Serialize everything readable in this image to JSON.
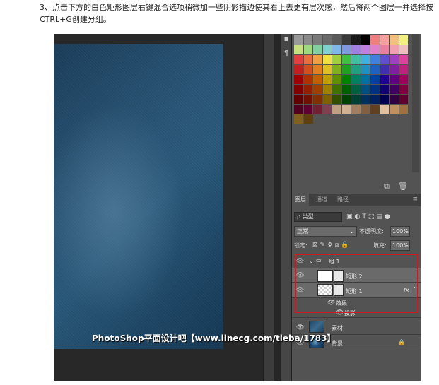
{
  "instruction": {
    "text": "3、点击下方的白色矩形图层右键混合选项稍微加一些阴影描边使其看上去更有层次感，然后将两个图层一并选择按CTRL+G创建分组。"
  },
  "colors": {
    "ps_dark": "#282828",
    "ps_panel": "#535353",
    "highlight_red": "#d2191c",
    "doc_blue": "#2a5678"
  },
  "swatches": [
    [
      "#9a9a9a",
      "#8a8a8a",
      "#7a7a7a",
      "#6a6a6a",
      "#5a5a5a",
      "#3a3a3a",
      "#1a1a1a",
      "#000000",
      "#f08080",
      "#f4a0a0",
      "#f4c080",
      "#f4f080"
    ],
    [
      "#c8e080",
      "#a0d880",
      "#80d0a0",
      "#80d0d0",
      "#80b8e8",
      "#8098e0",
      "#a080e0",
      "#c080e0",
      "#e080c8",
      "#e880a0",
      "#f0a0b0",
      "#f0c0c0"
    ],
    [
      "#e04040",
      "#e87040",
      "#f0a040",
      "#f0e040",
      "#a0d040",
      "#40c040",
      "#40c0a0",
      "#40b0e0",
      "#4080e0",
      "#6050d0",
      "#a040c0",
      "#e040a0"
    ],
    [
      "#c02020",
      "#d05020",
      "#e08020",
      "#e0c020",
      "#80b020",
      "#20a020",
      "#20a080",
      "#2090c0",
      "#2060c0",
      "#4030b0",
      "#8020a0",
      "#c02080"
    ],
    [
      "#a00000",
      "#b03000",
      "#c06000",
      "#c0a000",
      "#609000",
      "#008000",
      "#008060",
      "#0070a0",
      "#0040a0",
      "#200090",
      "#600080",
      "#a00060"
    ],
    [
      "#800000",
      "#902000",
      "#a04000",
      "#a08000",
      "#407000",
      "#006000",
      "#006040",
      "#005080",
      "#003080",
      "#100070",
      "#400060",
      "#800040"
    ],
    [
      "#600000",
      "#701000",
      "#803000",
      "#806000",
      "#305000",
      "#004000",
      "#004030",
      "#003060",
      "#002060",
      "#000050",
      "#300040",
      "#600030"
    ],
    [
      "#500020",
      "#600030",
      "#702030",
      "#804050",
      "#c0a080",
      "#d0b090",
      "#a08060",
      "#806040",
      "#604020",
      "#e0c0a0",
      "#c09060",
      "#a07040"
    ],
    [
      "#806020",
      "#604010"
    ]
  ],
  "layers_panel": {
    "tabs": [
      "图层",
      "通道",
      "路径"
    ],
    "filter_label": "ρ 类型",
    "blend_mode": "正常",
    "opacity_label": "不透明度:",
    "opacity_value": "100%",
    "lock_label": "锁定:",
    "fill_label": "填充:",
    "fill_value": "100%",
    "layers": [
      {
        "name": "组 1",
        "kind": "group"
      },
      {
        "name": "矩形 2",
        "kind": "shape"
      },
      {
        "name": "矩形 1",
        "kind": "shape",
        "fx": "fx"
      },
      {
        "name": "效果",
        "kind": "effects"
      },
      {
        "name": "投影",
        "kind": "effect"
      },
      {
        "name": "素材",
        "kind": "image"
      },
      {
        "name": "背景",
        "kind": "background"
      }
    ]
  },
  "watermark": {
    "text": "PhotoShop平面设计吧【www.linecg.com/tieba/1783】"
  }
}
